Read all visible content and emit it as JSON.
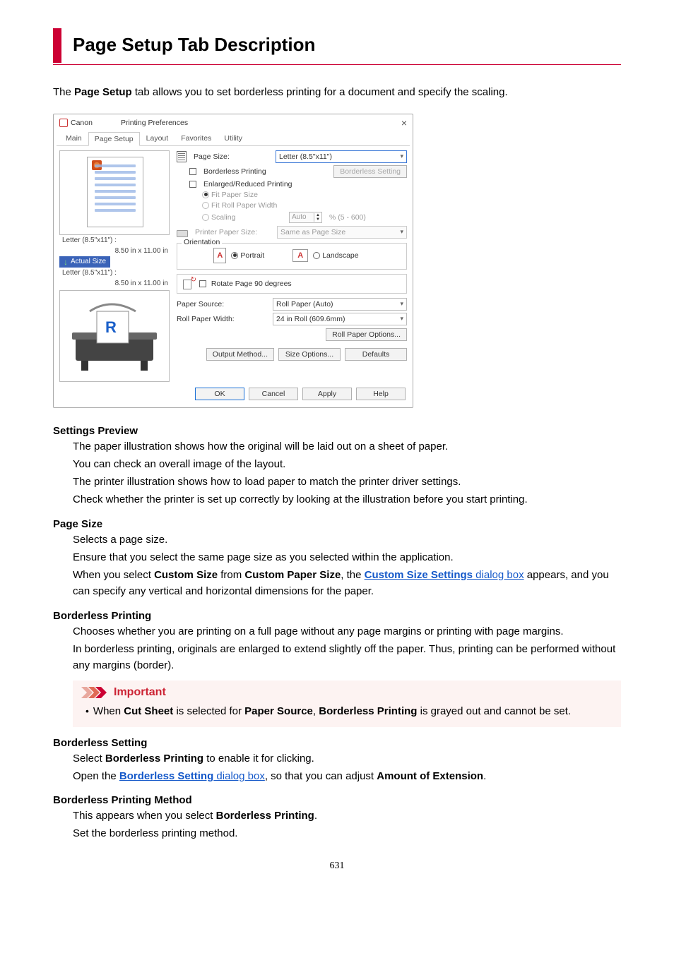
{
  "title": "Page Setup Tab Description",
  "intro_pre": "The ",
  "intro_bold": "Page Setup",
  "intro_post": " tab allows you to set borderless printing for a document and specify the scaling.",
  "dialog": {
    "brand": "Canon",
    "window_title": "Printing Preferences",
    "tabs": {
      "main": "Main",
      "page_setup": "Page Setup",
      "layout": "Layout",
      "favorites": "Favorites",
      "utility": "Utility"
    },
    "preview": {
      "size_label_1": "Letter (8.5\"x11\") :",
      "size_val_1": "8.50 in x 11.00 in",
      "actual": "Actual Size",
      "size_label_2": "Letter (8.5\"x11\") :",
      "size_val_2": "8.50 in x 11.00 in"
    },
    "fields": {
      "page_size_label": "Page Size:",
      "page_size_value": "Letter (8.5\"x11\")",
      "borderless_printing": "Borderless Printing",
      "borderless_setting_btn": "Borderless Setting",
      "enlarged_section": "Enlarged/Reduced Printing",
      "fit_paper": "Fit Paper Size",
      "fit_roll": "Fit Roll Paper Width",
      "scaling": "Scaling",
      "scaling_value": "Auto",
      "scaling_range": "% (5 - 600)",
      "printer_paper_size_label": "Printer Paper Size:",
      "printer_paper_size_value": "Same as Page Size",
      "orientation": "Orientation",
      "portrait": "Portrait",
      "landscape": "Landscape",
      "rotate90": "Rotate Page 90 degrees",
      "paper_source_label": "Paper Source:",
      "paper_source_value": "Roll Paper (Auto)",
      "roll_width_label": "Roll Paper Width:",
      "roll_width_value": "24 in Roll (609.6mm)",
      "roll_options_btn": "Roll Paper Options...",
      "output_method_btn": "Output Method...",
      "size_options_btn": "Size Options...",
      "defaults_btn": "Defaults"
    },
    "buttons": {
      "ok": "OK",
      "cancel": "Cancel",
      "apply": "Apply",
      "help": "Help"
    }
  },
  "sections": {
    "settings_preview": {
      "term": "Settings Preview",
      "p1": "The paper illustration shows how the original will be laid out on a sheet of paper.",
      "p2": "You can check an overall image of the layout.",
      "p3": "The printer illustration shows how to load paper to match the printer driver settings.",
      "p4": "Check whether the printer is set up correctly by looking at the illustration before you start printing."
    },
    "page_size": {
      "term": "Page Size",
      "p1": "Selects a page size.",
      "p2": "Ensure that you select the same page size as you selected within the application.",
      "p3_pre": "When you select ",
      "p3_b1": "Custom Size",
      "p3_mid1": " from ",
      "p3_b2": "Custom Paper Size",
      "p3_mid2": ", the ",
      "p3_link_b": "Custom Size Settings",
      "p3_link_rest": " dialog box",
      "p3_post": " appears, and you can specify any vertical and horizontal dimensions for the paper."
    },
    "borderless_printing": {
      "term": "Borderless Printing",
      "p1": "Chooses whether you are printing on a full page without any page margins or printing with page margins.",
      "p2": "In borderless printing, originals are enlarged to extend slightly off the paper. Thus, printing can be performed without any margins (border).",
      "important_label": "Important",
      "imp_pre": "When ",
      "imp_b1": "Cut Sheet",
      "imp_mid1": " is selected for ",
      "imp_b2": "Paper Source",
      "imp_mid2": ", ",
      "imp_b3": "Borderless Printing",
      "imp_post": " is grayed out and cannot be set."
    },
    "borderless_setting": {
      "term": "Borderless Setting",
      "p1_pre": "Select ",
      "p1_b": "Borderless Printing",
      "p1_post": " to enable it for clicking.",
      "p2_pre": "Open the ",
      "p2_link_b": "Borderless Setting",
      "p2_link_rest": " dialog box",
      "p2_mid": ", so that you can adjust ",
      "p2_b2": "Amount of Extension",
      "p2_end": "."
    },
    "borderless_method": {
      "term": "Borderless Printing Method",
      "p1_pre": "This appears when you select ",
      "p1_b": "Borderless Printing",
      "p1_post": ".",
      "p2": "Set the borderless printing method."
    }
  },
  "page_number": "631"
}
